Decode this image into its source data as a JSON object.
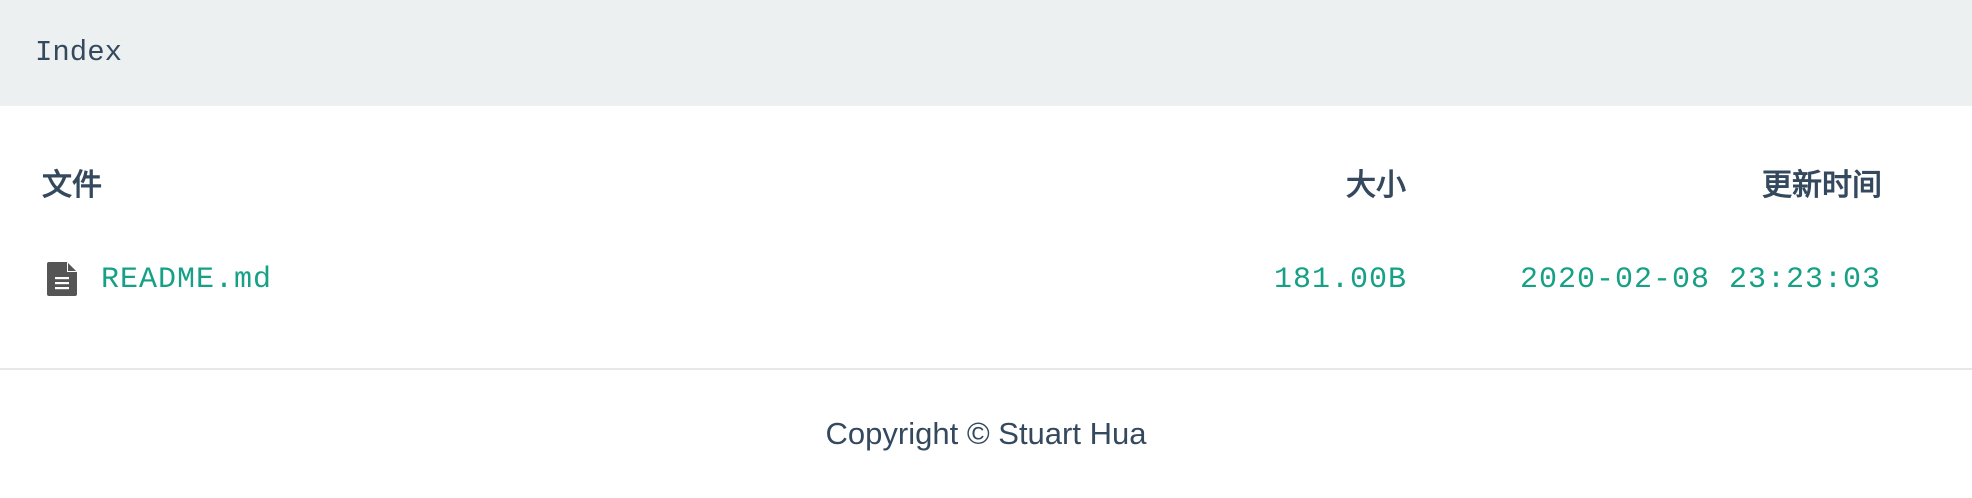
{
  "header": {
    "title": "Index"
  },
  "table": {
    "columns": {
      "file": "文件",
      "size": "大小",
      "modified": "更新时间"
    },
    "rows": [
      {
        "icon": "file-text-icon",
        "name": "README.md",
        "size": "181.00B",
        "modified": "2020-02-08 23:23:03"
      }
    ]
  },
  "footer": {
    "text": "Copyright © Stuart Hua"
  },
  "colors": {
    "header_bg": "#ecf0f1",
    "text": "#34495e",
    "link": "#16a085",
    "icon": "#555555"
  }
}
